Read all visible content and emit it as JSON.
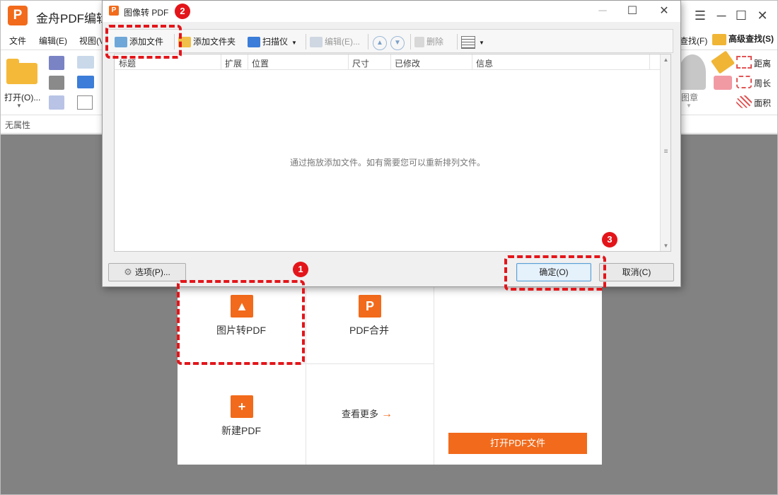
{
  "app": {
    "title": "金舟PDF编辑",
    "logo_letter": "P",
    "menu": [
      "文件",
      "编辑(E)",
      "视图(V"
    ],
    "ribbon": {
      "open_label": "打开(O)...",
      "find_label": "查找(F)",
      "advanced_find_label": "高级查找(S)",
      "stamp_label": "图章",
      "distance_label": "距离",
      "perimeter_label": "周长",
      "area_label": "面积"
    },
    "properties_label": "无属性"
  },
  "start_page": {
    "tiles": {
      "image_to_pdf": "图片转PDF",
      "pdf_merge": "PDF合并",
      "new_pdf": "新建PDF",
      "more": "查看更多"
    },
    "open_pdf_button": "打开PDF文件"
  },
  "dialog": {
    "title": "图像转 PDF",
    "toolbar": {
      "add_file": "添加文件",
      "add_folder": "添加文件夹",
      "scanner": "扫描仪",
      "edit": "编辑(E)...",
      "delete": "删除"
    },
    "columns": [
      "标题",
      "扩展",
      "位置",
      "尺寸",
      "已修改",
      "信息"
    ],
    "empty_hint": "通过拖放添加文件。如有需要您可以重新排列文件。",
    "options_button": "选项(P)...",
    "ok_button": "确定(O)",
    "cancel_button": "取消(C)"
  },
  "annotations": {
    "step1": "1",
    "step2": "2",
    "step3": "3"
  },
  "colors": {
    "brand": "#f26a1b",
    "annotation_red": "#e3151a",
    "workspace_gray": "#828282"
  }
}
